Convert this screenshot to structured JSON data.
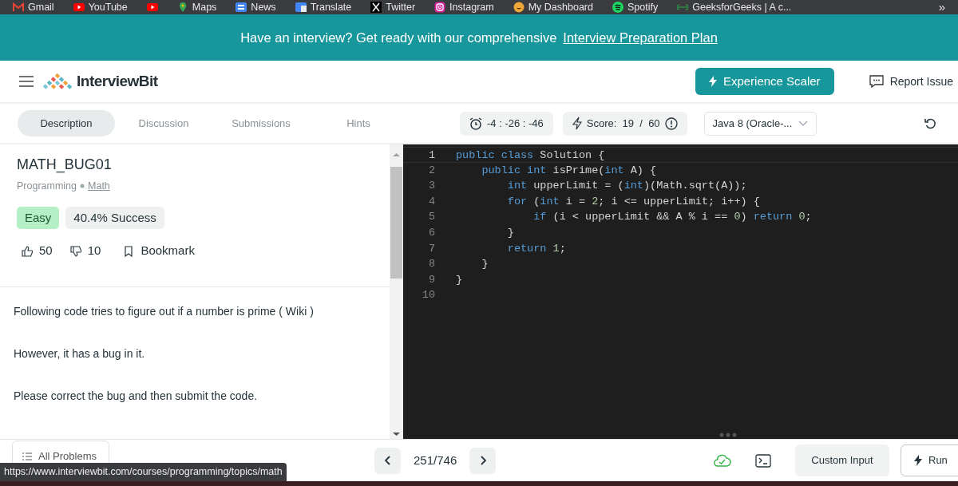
{
  "bookmarks": [
    {
      "kind": "link",
      "label": "Gmail"
    },
    {
      "kind": "link",
      "label": "YouTube"
    },
    {
      "kind": "icon"
    },
    {
      "kind": "link",
      "label": "Maps"
    },
    {
      "kind": "link",
      "label": "News"
    },
    {
      "kind": "link",
      "label": "Translate"
    },
    {
      "kind": "link",
      "label": "Twitter"
    },
    {
      "kind": "link",
      "label": "Instagram"
    },
    {
      "kind": "link",
      "label": "My Dashboard"
    },
    {
      "kind": "link",
      "label": "Spotify"
    },
    {
      "kind": "link",
      "label": "GeeksforGeeks | A c..."
    }
  ],
  "bookmarks_more": "»",
  "banner": {
    "text": "Have an interview? Get ready with our comprehensive",
    "link": "Interview Preparation Plan"
  },
  "header": {
    "logo": "InterviewBit",
    "cta": "Experience Scaler",
    "report": "Report Issue"
  },
  "tabs": [
    {
      "label": "Description",
      "selected": true
    },
    {
      "label": "Discussion",
      "selected": false
    },
    {
      "label": "Submissions",
      "selected": false
    },
    {
      "label": "Hints",
      "selected": false
    }
  ],
  "timer": "-4 : -26 : -46",
  "score": "Score:  19  /  60",
  "language": "Java 8 (Oracle-...",
  "problem": {
    "title": "MATH_BUG01",
    "category": "Programming",
    "topic": "Math",
    "difficulty": "Easy",
    "success": "40.4% Success",
    "likes": "50",
    "dislikes": "10",
    "bookmark": "Bookmark"
  },
  "description": [
    "Following code tries to figure out if a number is prime ( Wiki )",
    "However, it has a bug in it.",
    "Please correct the bug and then submit the code."
  ],
  "code": [
    {
      "number": "1",
      "selected": true,
      "tokens": [
        {
          "t": "public class ",
          "kind": "keyword"
        },
        {
          "t": "Solution {",
          "kind": "text"
        }
      ]
    },
    {
      "number": "2",
      "selected": false,
      "tokens": [
        {
          "t": "    public int ",
          "kind": "keyword"
        },
        {
          "t": "isPrime(",
          "kind": "text"
        },
        {
          "t": "int",
          "kind": "keyword"
        },
        {
          "t": " A) {",
          "kind": "text"
        }
      ]
    },
    {
      "number": "3",
      "selected": false,
      "tokens": [
        {
          "t": "        int ",
          "kind": "keyword"
        },
        {
          "t": "upperLimit = (",
          "kind": "text"
        },
        {
          "t": "int",
          "kind": "keyword"
        },
        {
          "t": ")(Math.sqrt(A));",
          "kind": "text"
        }
      ]
    },
    {
      "number": "4",
      "selected": false,
      "tokens": [
        {
          "t": "        for ",
          "kind": "keyword"
        },
        {
          "t": "(",
          "kind": "text"
        },
        {
          "t": "int",
          "kind": "keyword"
        },
        {
          "t": " i = ",
          "kind": "text"
        },
        {
          "t": "2",
          "kind": "number"
        },
        {
          "t": "; i <= upperLimit; i++) {",
          "kind": "text"
        }
      ]
    },
    {
      "number": "5",
      "selected": false,
      "tokens": [
        {
          "t": "            if ",
          "kind": "keyword"
        },
        {
          "t": "(i < upperLimit && A % i == ",
          "kind": "text"
        },
        {
          "t": "0",
          "kind": "number"
        },
        {
          "t": ") ",
          "kind": "text"
        },
        {
          "t": "return ",
          "kind": "keyword"
        },
        {
          "t": "0",
          "kind": "number"
        },
        {
          "t": ";",
          "kind": "text"
        }
      ]
    },
    {
      "number": "6",
      "selected": false,
      "tokens": [
        {
          "t": "        }",
          "kind": "text"
        }
      ]
    },
    {
      "number": "7",
      "selected": false,
      "tokens": [
        {
          "t": "        return ",
          "kind": "keyword"
        },
        {
          "t": "1",
          "kind": "number"
        },
        {
          "t": ";",
          "kind": "text"
        }
      ]
    },
    {
      "number": "8",
      "selected": false,
      "tokens": [
        {
          "t": "    }",
          "kind": "text"
        }
      ]
    },
    {
      "number": "9",
      "selected": false,
      "tokens": [
        {
          "t": "}",
          "kind": "text"
        }
      ]
    },
    {
      "number": "10",
      "selected": false
    }
  ],
  "footer": {
    "all_problems": "All Problems",
    "page": "251/746",
    "custom_input": "Custom Input",
    "run": "Run"
  },
  "status_url": "https://www.interviewbit.com/courses/programming/topics/math"
}
